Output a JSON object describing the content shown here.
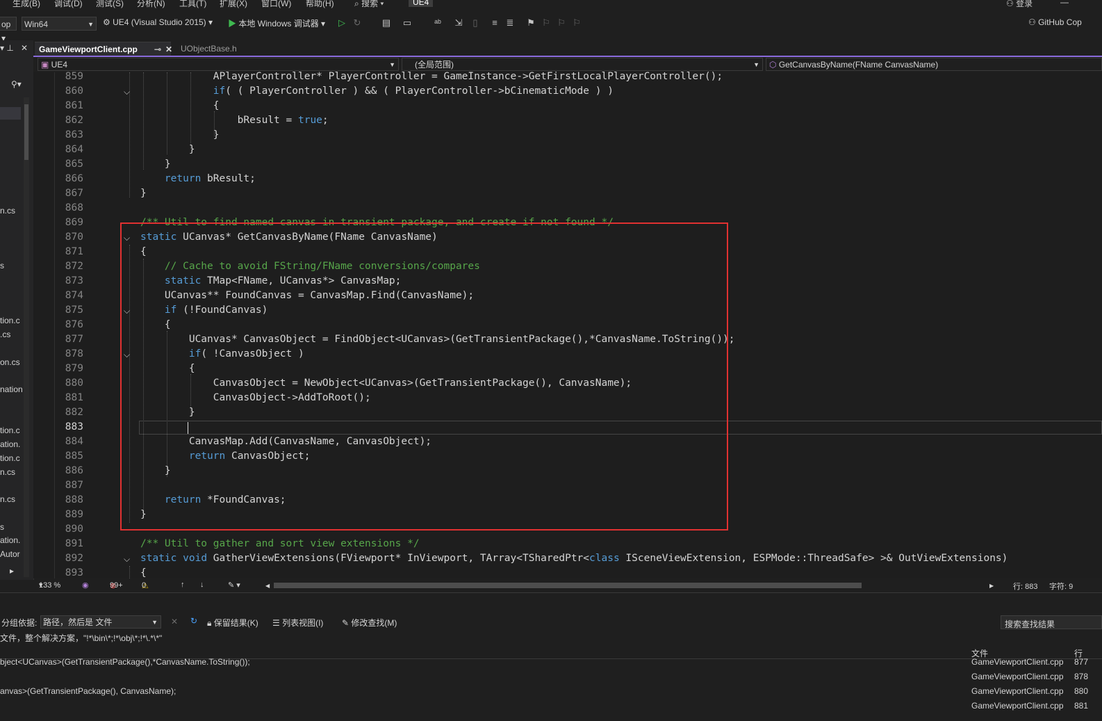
{
  "menu": [
    "生成(B)",
    "调试(D)",
    "测试(S)",
    "分析(N)",
    "工具(T)",
    "扩展(X)",
    "窗口(W)",
    "帮助(H)",
    "搜索",
    "UE4"
  ],
  "account": "登录",
  "toolbar": {
    "config": "op",
    "platform": "Win64",
    "project": "UE4 (Visual Studio 2015)",
    "debugger": "本地 Windows 调试器",
    "copilot": "GitHub Cop"
  },
  "left_panel": {
    "files": [
      "n.cs",
      "s",
      "tion.c",
      ".cs",
      "on.cs",
      "nation",
      "tion.c",
      "ation.",
      "tion.c",
      "n.cs",
      "n.cs",
      "s",
      "ation.",
      "Autor"
    ]
  },
  "tabs": [
    {
      "label": "GameViewportClient.cpp",
      "active": true
    },
    {
      "label": "UObjectBase.h",
      "active": false
    }
  ],
  "navbar": {
    "project": "UE4",
    "scope": "(全局范围)",
    "member": "GetCanvasByName(FName CanvasName)"
  },
  "editor": {
    "current_line": "883",
    "lines": [
      {
        "n": "859",
        "text": "            APlayerController* PlayerController = GameInstance->GetFirstLocalPlayerController();"
      },
      {
        "n": "860",
        "text": "            if( ( PlayerController ) && ( PlayerController->bCinematicMode ) )"
      },
      {
        "n": "861",
        "text": "            {"
      },
      {
        "n": "862",
        "text": "                bResult = true;"
      },
      {
        "n": "863",
        "text": "            }"
      },
      {
        "n": "864",
        "text": "        }"
      },
      {
        "n": "865",
        "text": "    }"
      },
      {
        "n": "866",
        "text": "    return bResult;"
      },
      {
        "n": "867",
        "text": "}"
      },
      {
        "n": "868",
        "text": ""
      },
      {
        "n": "869",
        "text": "/** Util to find named canvas in transient package, and create if not found */"
      },
      {
        "n": "870",
        "text": "static UCanvas* GetCanvasByName(FName CanvasName)"
      },
      {
        "n": "871",
        "text": "{"
      },
      {
        "n": "872",
        "text": "    // Cache to avoid FString/FName conversions/compares"
      },
      {
        "n": "873",
        "text": "    static TMap<FName, UCanvas*> CanvasMap;"
      },
      {
        "n": "874",
        "text": "    UCanvas** FoundCanvas = CanvasMap.Find(CanvasName);"
      },
      {
        "n": "875",
        "text": "    if (!FoundCanvas)"
      },
      {
        "n": "876",
        "text": "    {"
      },
      {
        "n": "877",
        "text": "        UCanvas* CanvasObject = FindObject<UCanvas>(GetTransientPackage(),*CanvasName.ToString());"
      },
      {
        "n": "878",
        "text": "        if( !CanvasObject )"
      },
      {
        "n": "879",
        "text": "        {"
      },
      {
        "n": "880",
        "text": "            CanvasObject = NewObject<UCanvas>(GetTransientPackage(), CanvasName);"
      },
      {
        "n": "881",
        "text": "            CanvasObject->AddToRoot();"
      },
      {
        "n": "882",
        "text": "        }"
      },
      {
        "n": "883",
        "text": ""
      },
      {
        "n": "884",
        "text": "        CanvasMap.Add(CanvasName, CanvasObject);"
      },
      {
        "n": "885",
        "text": "        return CanvasObject;"
      },
      {
        "n": "886",
        "text": "    }"
      },
      {
        "n": "887",
        "text": ""
      },
      {
        "n": "888",
        "text": "    return *FoundCanvas;"
      },
      {
        "n": "889",
        "text": "}"
      },
      {
        "n": "890",
        "text": ""
      },
      {
        "n": "891",
        "text": "/** Util to gather and sort view extensions */"
      },
      {
        "n": "892",
        "text": "static void GatherViewExtensions(FViewport* InViewport, TArray<TSharedPtr<class ISceneViewExtension, ESPMode::ThreadSafe> >& OutViewExtensions)"
      },
      {
        "n": "893",
        "text": "{"
      }
    ]
  },
  "status": {
    "zoom": "133 %",
    "errors": "99+",
    "warnings": "0",
    "line": "行: 883",
    "char": "字符: 9"
  },
  "find_panel": {
    "group_label": "分组依据:",
    "group_value": "路径，然后是 文件",
    "keep_results": "保留结果(K)",
    "list_view": "列表视图(I)",
    "modify_find": "修改查找(M)",
    "search_placeholder": "搜索查找结果",
    "scope_text": "文件，整个解决方案，\"!*\\bin\\*;!*\\obj\\*;!*\\.*\\*\"",
    "col_file": "文件",
    "col_line": "行",
    "results": [
      {
        "text": "bject<UCanvas>(GetTransientPackage(),*CanvasName.ToString());",
        "file": "GameViewportClient.cpp",
        "line": "877"
      },
      {
        "text": "",
        "file": "GameViewportClient.cpp",
        "line": "878"
      },
      {
        "text": "anvas>(GetTransientPackage(), CanvasName);",
        "file": "GameViewportClient.cpp",
        "line": "880"
      },
      {
        "text": "",
        "file": "GameViewportClient.cpp",
        "line": "881"
      }
    ]
  }
}
